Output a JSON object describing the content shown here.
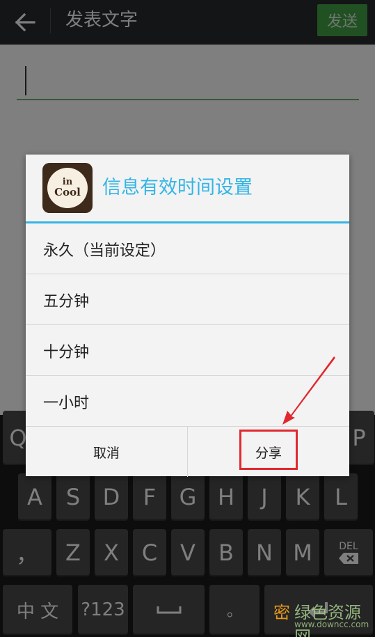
{
  "top_bar": {
    "title": "发表文字",
    "send_label": "发送"
  },
  "keyboard": {
    "row1_visible": [
      "Q",
      "P"
    ],
    "row2": [
      "A",
      "S",
      "D",
      "F",
      "G",
      "H",
      "J",
      "K",
      "L"
    ],
    "row3": [
      "，",
      "Z",
      "X",
      "C",
      "V",
      "B",
      "N",
      "M"
    ],
    "del_label": "DEL",
    "bottom": {
      "lang": "中 文",
      "sym": "?123",
      "period": "。"
    }
  },
  "dialog": {
    "title": "信息有效时间设置",
    "icon_text_line1": "in",
    "icon_text_line2": "Cool",
    "options": [
      "永久（当前设定）",
      "五分钟",
      "十分钟",
      "一小时"
    ],
    "cancel_label": "取消",
    "share_label": "分享"
  },
  "watermark": {
    "logo": "密",
    "text": "绿色资源网",
    "url": "www.downcc.com"
  },
  "colors": {
    "topbar": "#262b2f",
    "send": "#43a047",
    "accent": "#33b5e5",
    "highlight": "#e0282e"
  }
}
